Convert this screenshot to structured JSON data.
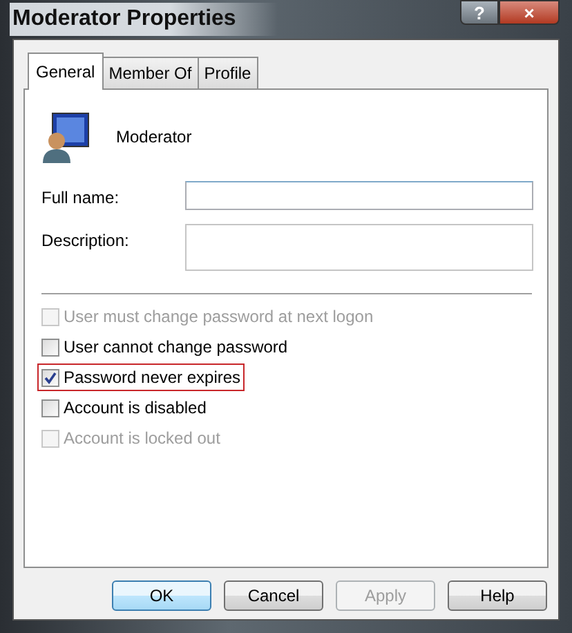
{
  "window": {
    "title": "Moderator Properties",
    "title_buttons": [
      {
        "kind": "help",
        "label": "?"
      },
      {
        "kind": "close",
        "label": "×"
      }
    ]
  },
  "tabs": [
    {
      "label": "General",
      "selected": true
    },
    {
      "label": "Member Of",
      "selected": false
    },
    {
      "label": "Profile",
      "selected": false
    }
  ],
  "user": {
    "name": "Moderator"
  },
  "fields": [
    {
      "label": "Full name:",
      "kind": "line"
    },
    {
      "label": "Description:",
      "kind": "area"
    }
  ],
  "checkboxes": [
    {
      "label": "User must change password at next logon",
      "checked": false,
      "disabled": true,
      "highlighted": false
    },
    {
      "label": "User cannot change password",
      "checked": false,
      "disabled": false,
      "highlighted": false
    },
    {
      "label": "Password never expires",
      "checked": true,
      "disabled": false,
      "highlighted": true
    },
    {
      "label": "Account is disabled",
      "checked": false,
      "disabled": false,
      "highlighted": false
    },
    {
      "label": "Account is locked out",
      "checked": false,
      "disabled": true,
      "highlighted": false
    }
  ],
  "buttons": [
    {
      "label": "OK",
      "default": true,
      "disabled": false
    },
    {
      "label": "Cancel",
      "default": false,
      "disabled": false
    },
    {
      "label": "Apply",
      "default": false,
      "disabled": true
    },
    {
      "label": "Help",
      "default": false,
      "disabled": false
    }
  ]
}
